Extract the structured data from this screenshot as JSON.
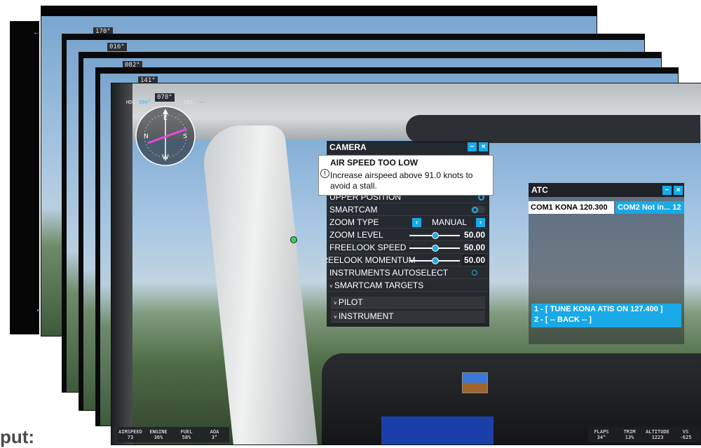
{
  "back_layers": [
    {
      "heading": "170°"
    },
    {
      "heading": "016°"
    },
    {
      "heading": "082°"
    },
    {
      "heading": "141°"
    }
  ],
  "front": {
    "compass": {
      "heading": "078°",
      "hdg_label": "HDG",
      "hdg_value": "304°",
      "crs_label": "CRS",
      "crs_value": "---"
    },
    "camera_panel": {
      "title": "CAMERA",
      "min_icon": "minimize-icon",
      "close_icon": "close-icon",
      "alert": {
        "title": "AIR SPEED TOO LOW",
        "message": "Increase airspeed above 91.0 knots to avoid a stall."
      },
      "rows": {
        "upper_position": "UPPER POSITION",
        "smartcam": "SMARTCAM",
        "zoom_type": "ZOOM TYPE",
        "zoom_type_value": "MANUAL",
        "zoom_level": "ZOOM LEVEL",
        "zoom_level_value": "50.00",
        "freelook_speed": "FREELOOK SPEED",
        "freelook_speed_value": "50.00",
        "freelook_momentum": "FREELOOK MOMENTUM",
        "freelook_momentum_value": "50.00",
        "instruments_autoselect": "INSTRUMENTS AUTOSELECT",
        "smartcam_targets": "SMARTCAM TARGETS",
        "pilot": "PILOT",
        "instrument": "INSTRUMENT"
      },
      "slider_levels": {
        "zoom_level": 0.5,
        "freelook_speed": 0.5,
        "freelook_momentum": 0.5
      }
    },
    "atc_panel": {
      "title": "ATC",
      "com1": "COM1 KONA 120.300",
      "com2": "COM2 Not in... 12",
      "options": [
        "1 - [ TUNE KONA ATIS ON 127.400 ]",
        "2 - [ -- BACK -- ]"
      ]
    },
    "bottom_bar": [
      {
        "label": "AIRSPEED",
        "value": "73"
      },
      {
        "label": "ENGINE",
        "value": "36%"
      },
      {
        "label": "FUEL",
        "value": "58%"
      },
      {
        "label": "AOA",
        "value": "3°"
      }
    ],
    "bottom_right": [
      {
        "label": "FLAPS",
        "value": "34°"
      },
      {
        "label": "TRIM",
        "value": "13%"
      },
      {
        "label": "ALTITUDE",
        "value": "1223"
      },
      {
        "label": "VS",
        "value": "-625"
      }
    ]
  },
  "caption": "put:",
  "colors": {
    "accent": "#19a9e6",
    "panel_bg": "#1c1e22",
    "alert_bg": "#ffffff"
  }
}
